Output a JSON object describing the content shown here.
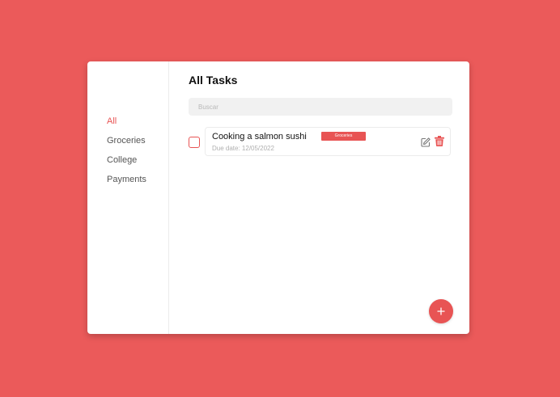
{
  "sidebar": {
    "items": [
      {
        "label": "All",
        "active": true
      },
      {
        "label": "Groceries",
        "active": false
      },
      {
        "label": "College",
        "active": false
      },
      {
        "label": "Payments",
        "active": false
      }
    ]
  },
  "main": {
    "title": "All Tasks",
    "search": {
      "placeholder": "Buscar",
      "value": ""
    },
    "tasks": [
      {
        "name": "Cooking a salmon sushi",
        "tag": "Groceries",
        "due": "Due date: 12/05/2022",
        "completed": false
      }
    ]
  },
  "icons": {
    "edit": "edit-icon",
    "delete": "trash-icon",
    "add": "plus-icon"
  },
  "colors": {
    "background": "#EB5A5A",
    "accent": "#E85454",
    "card": "#FFFFFF"
  }
}
